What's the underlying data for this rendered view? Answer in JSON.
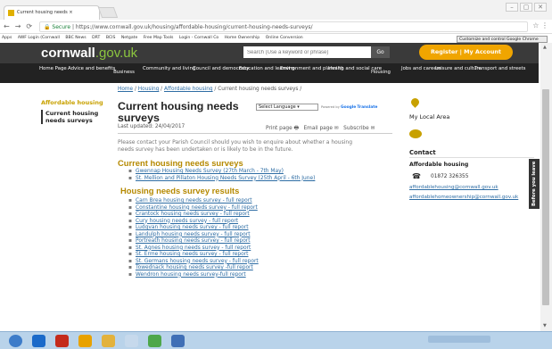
{
  "browser": {
    "tab_title": "Current housing needs ×",
    "url_secure": "Secure",
    "url": "https://www.cornwall.gov.uk/housing/affordable-housing/current-housing-needs-surveys/",
    "bookmarks": [
      "Apps",
      "AWF Login (Cornwall",
      "BBC News",
      "DRT",
      "BCIS",
      "Netgate",
      "Free Map Tools",
      "Login - Cornwall Co",
      "Home Ownership",
      "Online Conversion"
    ],
    "tooltip": "Customize and control Google Chrome"
  },
  "header": {
    "logo_main": "cornwall",
    "logo_tld": ".gov.uk",
    "search_placeholder": "Search (Use a keyword or phrase)",
    "go_label": "Go",
    "register_label": "Register | My Account"
  },
  "menu": [
    "Home Page",
    "Advice and benefits",
    "Business",
    "Community and living",
    "Council and democracy",
    "Education and learning",
    "Environment and planning",
    "Health and social care",
    "Housing",
    "Jobs and careers",
    "Leisure and culture",
    "Transport and streets"
  ],
  "breadcrumb": {
    "home": "Home",
    "housing": "Housing",
    "affordable": "Affordable housing",
    "current": "Current housing needs surveys"
  },
  "sidebar": {
    "title": "Affordable housing",
    "current": "Current housing needs surveys"
  },
  "page": {
    "title": "Current housing needs surveys",
    "language": "Select Language",
    "powered_prefix": "Powered by",
    "powered_brand": "Google",
    "translate": "Translate",
    "last_updated": "Last updated: 24/04/2017",
    "print": "Print page",
    "email": "Email page",
    "subscribe": "Subscribe",
    "intro": "Please contact your Parish Council should you wish to enquire about whether a housing needs survey has been undertaken or is likely to be in the future.",
    "current_heading": "Current housing needs surveys",
    "current_links": [
      "Gwennap Housing Needs Survey (27th March - 7th May)",
      "St. Mellion and Pillaton Housing Needs Survey (25th April - 6th June)"
    ],
    "results_heading": "Housing needs survey results",
    "results_links": [
      "Carn Brea housing needs survey - full report",
      "Constantine housing needs survey - full report",
      "Crantock housing needs survey - full report",
      "Cury housing needs survey - full report",
      "Ludgvan housing needs survey - full report",
      "Landulph housing needs survey - full report",
      "Portreath housing needs survey - full report",
      "St. Agnes housing needs survey - full report",
      "St. Erme housing needs survey - full report",
      "St. Germans housing needs survey - full report",
      "Towednack housing needs survey -full report",
      "Wendron housing needs survey-full report"
    ]
  },
  "right": {
    "my_local_area": "My Local Area",
    "contact": "Contact",
    "affordable_housing": "Affordable housing",
    "phone": "01872 326355",
    "email1": "affordablehousing@cornwall.gov.uk",
    "email2": "affordablehomeownership@cornwall.gov.uk"
  },
  "feedback": "Before you leave",
  "colors": {
    "accent_gold": "#c8a100",
    "header_dark": "#3a3a3a",
    "register_orange": "#f0a500",
    "link_blue": "#2e6da4"
  }
}
